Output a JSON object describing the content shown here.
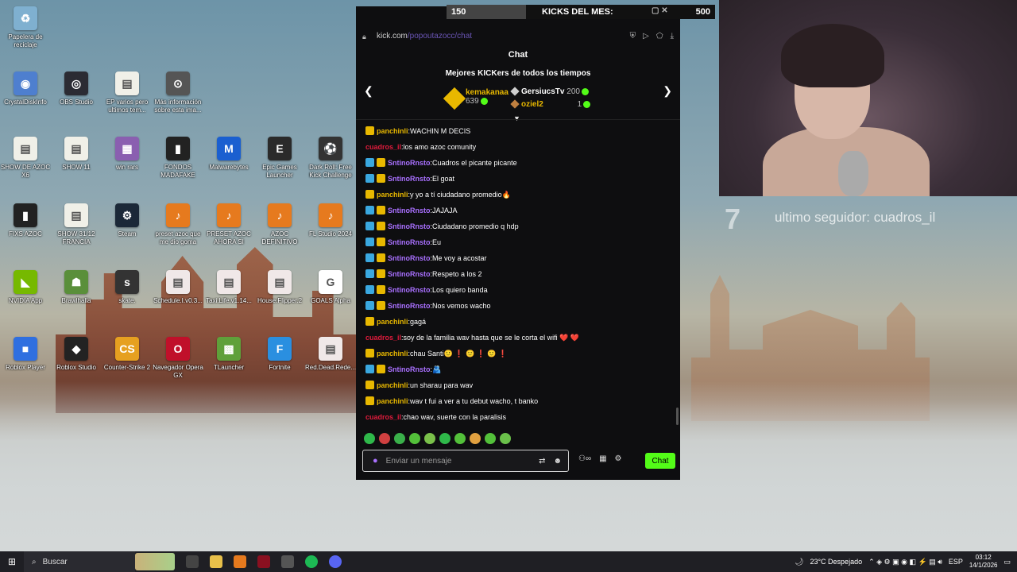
{
  "desktop_icons": [
    {
      "label": "Papelera de reciclaje",
      "color": "#7fb0d0",
      "glyph": "♻"
    },
    {
      "label": "CrystalDiskInfo",
      "color": "#4e7fcf",
      "glyph": "◉"
    },
    {
      "label": "OBS Studio",
      "color": "#2b2b33",
      "glyph": "◎"
    },
    {
      "label": "EP varios pero ultimos tem...",
      "color": "#f0f0e8",
      "glyph": "▤"
    },
    {
      "label": "Más información sobre esta ima...",
      "color": "#555",
      "glyph": "⊙"
    },
    {
      "label": "SHOW DE AZOC X6",
      "color": "#f0f0e8",
      "glyph": "▤"
    },
    {
      "label": "SHOW 11",
      "color": "#f0f0e8",
      "glyph": "▤"
    },
    {
      "label": "win rars",
      "color": "#8a5fb0",
      "glyph": "▦"
    },
    {
      "label": "FONDOS MADAFAKE",
      "color": "#222",
      "glyph": "▮"
    },
    {
      "label": "Malwarebytes",
      "color": "#1a5fd0",
      "glyph": "M"
    },
    {
      "label": "Epic Games Launcher",
      "color": "#2a2a2a",
      "glyph": "E"
    },
    {
      "label": "Dark Roll: Free Kick Challenge",
      "color": "#333",
      "glyph": "⚽"
    },
    {
      "label": "FIXS AZOC",
      "color": "#222",
      "glyph": "▮"
    },
    {
      "label": "SHOW 31/12 FRANCIA",
      "color": "#f0f0e8",
      "glyph": "▤"
    },
    {
      "label": "Steam",
      "color": "#1b2838",
      "glyph": "⚙"
    },
    {
      "label": "preset azoc que me dio goma",
      "color": "#e67a1e",
      "glyph": "♪"
    },
    {
      "label": "PRESET AZOC AHORA SI",
      "color": "#e67a1e",
      "glyph": "♪"
    },
    {
      "label": "AZOC DEFINITIVO",
      "color": "#e67a1e",
      "glyph": "♪"
    },
    {
      "label": "FL Studio 2024",
      "color": "#e67a1e",
      "glyph": "♪"
    },
    {
      "label": "NVIDIA App",
      "color": "#76b900",
      "glyph": "◣"
    },
    {
      "label": "Brawlhalla",
      "color": "#5a8f3a",
      "glyph": "☗"
    },
    {
      "label": "skate.",
      "color": "#333",
      "glyph": "s"
    },
    {
      "label": "Schedule.I.v0.3...",
      "color": "#f0e8e8",
      "glyph": "▤"
    },
    {
      "label": "Taxi.Life.v1.14...",
      "color": "#f0e8e8",
      "glyph": "▤"
    },
    {
      "label": "House.Flipper.2",
      "color": "#f0e8e8",
      "glyph": "▤"
    },
    {
      "label": "GOALS Alpha",
      "color": "#fff",
      "glyph": "G"
    },
    {
      "label": "Roblox Player",
      "color": "#2f6fe0",
      "glyph": "■"
    },
    {
      "label": "Roblox Studio",
      "color": "#222",
      "glyph": "◆"
    },
    {
      "label": "Counter-Strike 2",
      "color": "#e6a020",
      "glyph": "CS"
    },
    {
      "label": "Navegador Opera GX",
      "color": "#c0102a",
      "glyph": "O"
    },
    {
      "label": "TLauncher",
      "color": "#5fa03a",
      "glyph": "▩"
    },
    {
      "label": "Fortnite",
      "color": "#2a8fe0",
      "glyph": "F"
    },
    {
      "label": "Red.Dead.Rede...",
      "color": "#f0e8e8",
      "glyph": "▤"
    }
  ],
  "kicks_bar": {
    "left": "150",
    "title": "KICKS DEL MES:",
    "right": "500"
  },
  "browser": {
    "host": "kick.com",
    "path": "/popoutazocc/chat"
  },
  "chat": {
    "title": "Chat",
    "leaderboard_title": "Mejores KICKers de todos los tiempos",
    "leaders": [
      {
        "name": "kemakanaa",
        "count": "639"
      },
      {
        "name": "GersiucsTv",
        "count": "200"
      },
      {
        "name": "oziel2",
        "count": "1"
      }
    ],
    "messages": [
      {
        "badges": [
          "sub"
        ],
        "user": "panchinli",
        "color": "yellow",
        "text": "WACHIN M DECIS"
      },
      {
        "badges": [],
        "user": "cuadros_il",
        "color": "red",
        "text": "los amo azoc comunity"
      },
      {
        "badges": [
          "mod",
          "sub"
        ],
        "user": "SntinoRnsto",
        "color": "purple",
        "text": "Cuadros el picante picante"
      },
      {
        "badges": [
          "mod",
          "sub"
        ],
        "user": "SntinoRnsto",
        "color": "purple",
        "text": "El goat"
      },
      {
        "badges": [
          "sub"
        ],
        "user": "panchinli",
        "color": "yellow",
        "text": "y yo a tí ciudadano promedio🔥"
      },
      {
        "badges": [
          "mod",
          "sub"
        ],
        "user": "SntinoRnsto",
        "color": "purple",
        "text": "JAJAJA"
      },
      {
        "badges": [
          "mod",
          "sub"
        ],
        "user": "SntinoRnsto",
        "color": "purple",
        "text": "Ciudadano promedio q hdp"
      },
      {
        "badges": [
          "mod",
          "sub"
        ],
        "user": "SntinoRnsto",
        "color": "purple",
        "text": "Eu"
      },
      {
        "badges": [
          "mod",
          "sub"
        ],
        "user": "SntinoRnsto",
        "color": "purple",
        "text": "Me voy a acostar"
      },
      {
        "badges": [
          "mod",
          "sub"
        ],
        "user": "SntinoRnsto",
        "color": "purple",
        "text": "Respeto a los 2"
      },
      {
        "badges": [
          "mod",
          "sub"
        ],
        "user": "SntinoRnsto",
        "color": "purple",
        "text": "Los quiero banda"
      },
      {
        "badges": [
          "mod",
          "sub"
        ],
        "user": "SntinoRnsto",
        "color": "purple",
        "text": "Nos vemos wacho"
      },
      {
        "badges": [
          "sub"
        ],
        "user": "panchinli",
        "color": "yellow",
        "text": "gagá"
      },
      {
        "badges": [],
        "user": "cuadros_il",
        "color": "red",
        "text": "soy de la familia wav hasta que se le corta el wifi ❤️ ❤️"
      },
      {
        "badges": [
          "sub"
        ],
        "user": "panchinli",
        "color": "yellow",
        "text": "chau Santi🙂 ❗ 🙂 ❗ 🙂 ❗"
      },
      {
        "badges": [
          "mod",
          "sub"
        ],
        "user": "SntinoRnsto",
        "color": "purple",
        "text": "🫂"
      },
      {
        "badges": [
          "sub"
        ],
        "user": "panchinli",
        "color": "yellow",
        "text": "un sharau para wav"
      },
      {
        "badges": [
          "sub"
        ],
        "user": "panchinli",
        "color": "yellow",
        "text": "wav t fui a ver a tu debut wacho, t banko"
      },
      {
        "badges": [],
        "user": "cuadros_il",
        "color": "red",
        "text": "chao wav, suerte con la paralisis"
      }
    ],
    "input_placeholder": "Enviar un mensaje",
    "send_label": "Chat",
    "accent": "#53fc18"
  },
  "overlay": {
    "segment_number": "7",
    "follower_text": "ultimo seguidor: cuadros_il"
  },
  "taskbar": {
    "search_label": "Buscar",
    "weather": "23°C Despejado",
    "lang": "ESP",
    "time": "03:12",
    "date": "14/1/2026"
  }
}
